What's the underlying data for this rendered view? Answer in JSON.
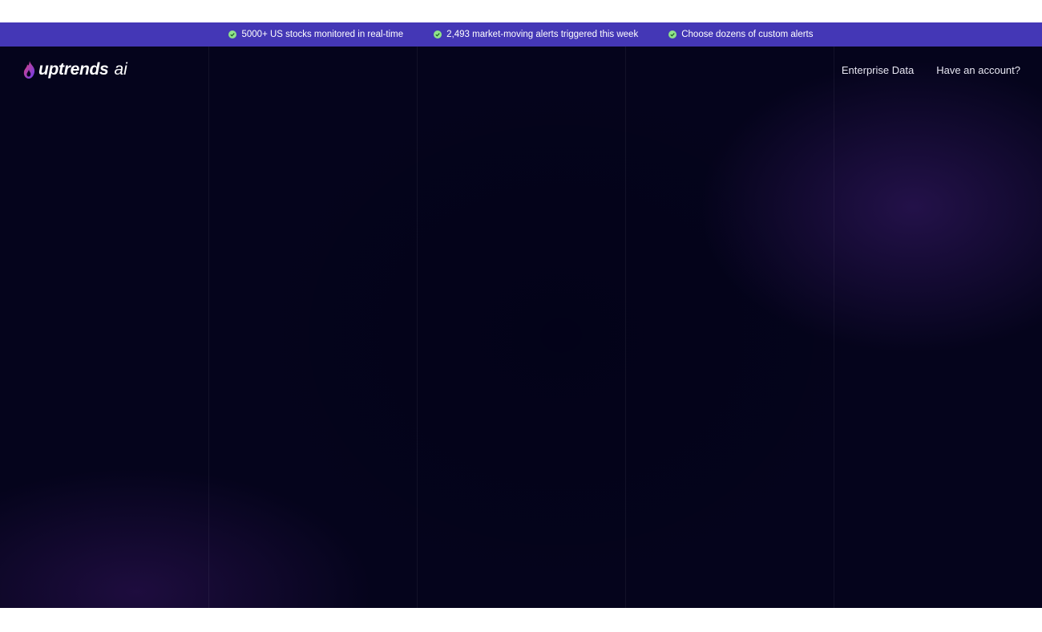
{
  "announcement_bar": {
    "items": [
      {
        "icon": "check-circle-icon",
        "text": "5000+ US stocks monitored in real-time"
      },
      {
        "icon": "check-circle-icon",
        "text": "2,493 market-moving alerts triggered this week"
      },
      {
        "icon": "check-circle-icon",
        "text": "Choose dozens of custom alerts"
      }
    ],
    "background": "#4437b6",
    "icon_color": "#8fe38a"
  },
  "header": {
    "logo": {
      "name": "uptrends",
      "suffix": "ai"
    },
    "nav": [
      {
        "label": "Enterprise Data"
      },
      {
        "label": "Have an account?"
      }
    ]
  },
  "colors": {
    "hero_background": "#05041c",
    "accent_purple": "#3c1c6e",
    "logo_gradient_start": "#e0437a",
    "logo_gradient_end": "#6a3df0"
  }
}
